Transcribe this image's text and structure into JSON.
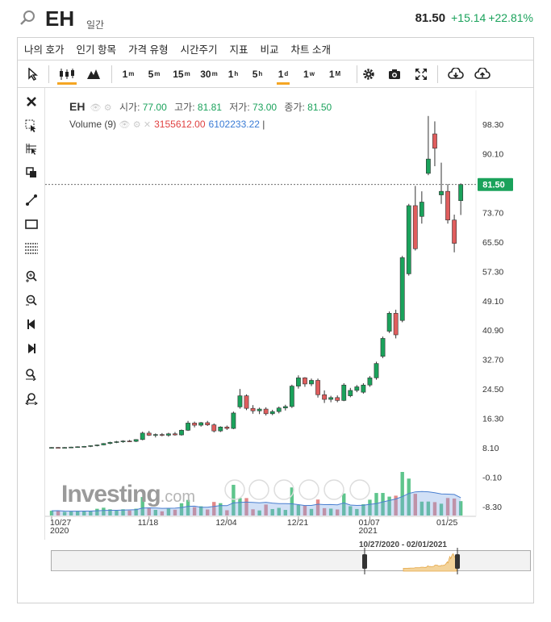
{
  "header": {
    "symbol": "EH",
    "period_label": "일간",
    "last": "81.50",
    "change": "+15.14",
    "change_pct": "+22.81%",
    "up_color": "#1aa25b",
    "down_color": "#e05d5d"
  },
  "menu": [
    "나의 호가",
    "인기 항목",
    "가격 유형",
    "시간주기",
    "지표",
    "비교",
    "차트 소개"
  ],
  "toolbar": {
    "intervals": [
      {
        "base": "1",
        "unit": "m"
      },
      {
        "base": "5",
        "unit": "m"
      },
      {
        "base": "15",
        "unit": "m"
      },
      {
        "base": "30",
        "unit": "m"
      },
      {
        "base": "1",
        "unit": "h"
      },
      {
        "base": "5",
        "unit": "h"
      },
      {
        "base": "1",
        "unit": "d"
      },
      {
        "base": "1",
        "unit": "w"
      },
      {
        "base": "1",
        "unit": "M"
      }
    ],
    "active_interval": 6
  },
  "legend": {
    "symbol": "EH",
    "open_label": "시가:",
    "open": "77.00",
    "high_label": "고가:",
    "high": "81.81",
    "low_label": "저가:",
    "low": "73.00",
    "close_label": "종가:",
    "close": "81.50",
    "volume_label": "Volume (9)",
    "volume_1": "3155612.00",
    "volume_2": "6102233.22",
    "volume_2_suffix": "|"
  },
  "watermark": {
    "main": "Investing",
    "suffix": ".com"
  },
  "navigator": {
    "range_label": "10/27/2020 - 02/01/2021"
  },
  "chart_data": {
    "type": "candlestick",
    "y_ticks": [
      "98.30",
      "90.10",
      "81.90",
      "73.70",
      "65.50",
      "57.30",
      "49.10",
      "40.90",
      "32.70",
      "24.50",
      "16.30",
      "8.10",
      "-0.10",
      "-8.30"
    ],
    "ylim": [
      -8.3,
      98.3
    ],
    "current_price_label": "81.50",
    "x_ticks": [
      {
        "label": "10/27",
        "sub": "2020",
        "i": 0
      },
      {
        "label": "11/18",
        "sub": "",
        "i": 15
      },
      {
        "label": "12/04",
        "sub": "",
        "i": 27
      },
      {
        "label": "12/21",
        "sub": "",
        "i": 38
      },
      {
        "label": "01/07",
        "sub": "2021",
        "i": 49
      },
      {
        "label": "01/25",
        "sub": "",
        "i": 61
      }
    ],
    "candles": [
      [
        8.1,
        8.3,
        7.9,
        8.2
      ],
      [
        8.2,
        8.3,
        8.0,
        8.1
      ],
      [
        8.1,
        8.3,
        8.0,
        8.2
      ],
      [
        8.2,
        8.4,
        8.0,
        8.3
      ],
      [
        8.3,
        8.5,
        8.1,
        8.4
      ],
      [
        8.4,
        8.6,
        8.2,
        8.5
      ],
      [
        8.5,
        8.8,
        8.3,
        8.7
      ],
      [
        8.7,
        9.0,
        8.5,
        8.9
      ],
      [
        8.9,
        9.4,
        8.8,
        9.3
      ],
      [
        9.3,
        9.8,
        9.1,
        9.6
      ],
      [
        9.6,
        10.0,
        9.4,
        9.8
      ],
      [
        9.8,
        10.2,
        9.5,
        10.0
      ],
      [
        10.0,
        10.3,
        9.7,
        9.9
      ],
      [
        9.9,
        10.5,
        9.7,
        10.4
      ],
      [
        10.4,
        12.6,
        10.2,
        12.2
      ],
      [
        12.2,
        12.8,
        11.4,
        11.6
      ],
      [
        11.6,
        12.1,
        11.0,
        11.8
      ],
      [
        11.8,
        12.2,
        11.3,
        11.6
      ],
      [
        11.6,
        12.3,
        11.2,
        12.0
      ],
      [
        12.0,
        12.5,
        11.5,
        11.7
      ],
      [
        11.7,
        13.2,
        11.5,
        13.0
      ],
      [
        13.0,
        15.6,
        12.8,
        15.0
      ],
      [
        15.0,
        15.4,
        13.8,
        14.4
      ],
      [
        14.4,
        15.3,
        14.0,
        15.1
      ],
      [
        15.1,
        15.6,
        14.2,
        14.5
      ],
      [
        14.5,
        14.9,
        12.4,
        12.8
      ],
      [
        12.8,
        14.1,
        12.5,
        13.9
      ],
      [
        13.9,
        14.3,
        13.1,
        13.5
      ],
      [
        13.5,
        18.2,
        13.3,
        17.8
      ],
      [
        19.5,
        24.5,
        19.0,
        22.6
      ],
      [
        22.6,
        23.0,
        18.6,
        19.1
      ],
      [
        19.1,
        20.0,
        17.6,
        18.4
      ],
      [
        18.4,
        19.3,
        17.5,
        18.9
      ],
      [
        18.9,
        19.4,
        17.1,
        17.6
      ],
      [
        17.6,
        18.7,
        17.2,
        18.2
      ],
      [
        18.2,
        19.6,
        17.7,
        19.2
      ],
      [
        19.2,
        20.1,
        18.5,
        19.6
      ],
      [
        19.6,
        25.7,
        19.2,
        25.3
      ],
      [
        25.3,
        28.3,
        24.6,
        27.6
      ],
      [
        27.6,
        27.8,
        25.1,
        25.9
      ],
      [
        25.9,
        27.4,
        25.3,
        26.9
      ],
      [
        26.9,
        27.4,
        22.1,
        22.9
      ],
      [
        22.9,
        24.1,
        20.6,
        21.6
      ],
      [
        21.6,
        22.6,
        20.8,
        22.1
      ],
      [
        22.1,
        22.7,
        20.8,
        21.3
      ],
      [
        21.3,
        26.1,
        21.1,
        25.6
      ],
      [
        22.6,
        24.8,
        22.2,
        24.1
      ],
      [
        24.1,
        25.6,
        23.6,
        25.1
      ],
      [
        23.6,
        26.1,
        23.2,
        25.6
      ],
      [
        25.6,
        28.1,
        25.1,
        27.6
      ],
      [
        27.6,
        32.1,
        27.1,
        31.6
      ],
      [
        33.6,
        39.1,
        33.1,
        38.6
      ],
      [
        40.6,
        46.1,
        40.1,
        45.6
      ],
      [
        45.6,
        46.6,
        38.6,
        39.6
      ],
      [
        43.6,
        61.6,
        43.1,
        61.1
      ],
      [
        56.6,
        76.1,
        56.1,
        75.6
      ],
      [
        75.6,
        81.1,
        63.1,
        63.6
      ],
      [
        72.6,
        79.6,
        70.6,
        76.6
      ],
      [
        84.6,
        100.6,
        84.1,
        88.6
      ],
      [
        95.6,
        99.1,
        86.6,
        91.6
      ],
      [
        78.6,
        87.6,
        76.1,
        79.6
      ],
      [
        79.6,
        81.6,
        70.6,
        71.6
      ],
      [
        71.6,
        73.1,
        62.6,
        65.1
      ],
      [
        77.0,
        81.81,
        73.0,
        81.5
      ]
    ],
    "volume_note": "volume bars shown at bottom, scale not labeled"
  }
}
